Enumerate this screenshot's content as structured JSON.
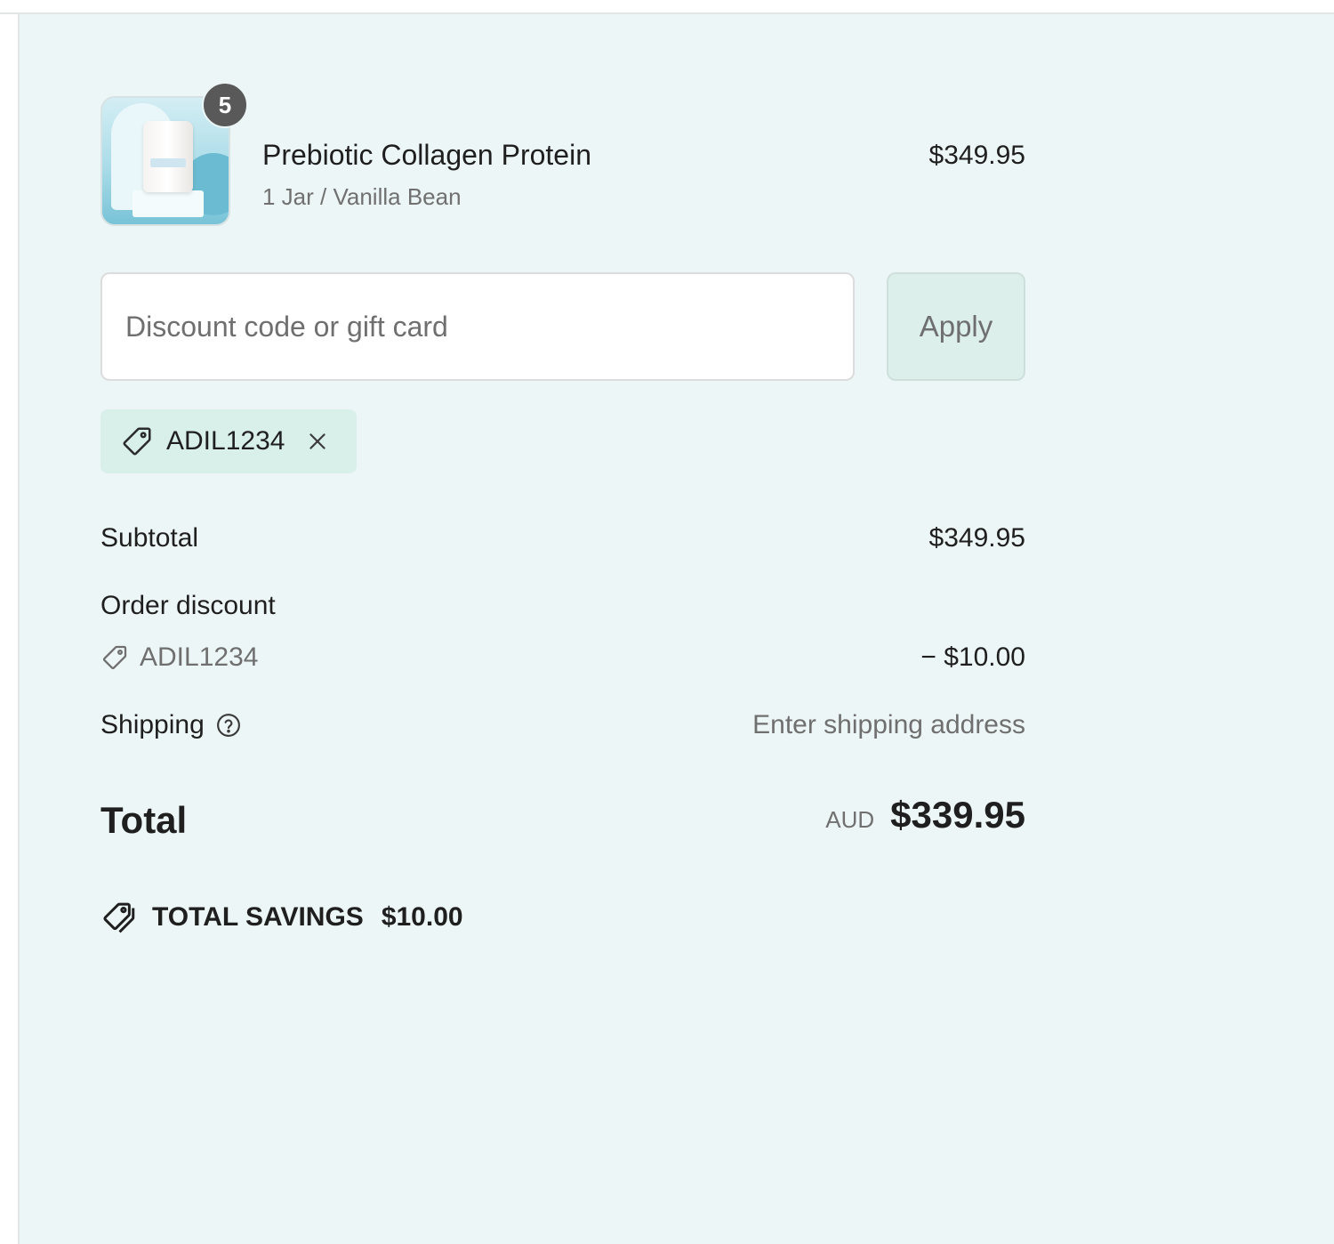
{
  "product": {
    "quantity": "5",
    "name": "Prebiotic Collagen Protein",
    "variant": "1 Jar / Vanilla Bean",
    "price": "$349.95",
    "image_icon": "product-jar-image"
  },
  "discount": {
    "placeholder": "Discount code or gift card",
    "value": "",
    "apply_label": "Apply",
    "applied_code": "ADIL1234"
  },
  "totals": {
    "subtotal_label": "Subtotal",
    "subtotal_value": "$349.95",
    "order_discount_label": "Order discount",
    "order_discount_code": "ADIL1234",
    "order_discount_value": "− $10.00",
    "shipping_label": "Shipping",
    "shipping_value": "Enter shipping address",
    "total_label": "Total",
    "currency": "AUD",
    "total_value": "$339.95"
  },
  "savings": {
    "label": "TOTAL SAVINGS",
    "amount": "$10.00"
  },
  "colors": {
    "panel_background": "#edf6f6",
    "chip_background": "#d9efe9",
    "apply_button_background": "#dcefea",
    "badge": "#595959",
    "text_primary": "#1f1f1f",
    "text_muted": "#6f6f6f"
  },
  "icons": {
    "chip_tag": "tag-icon",
    "chip_remove": "close-icon",
    "discount_tag": "tag-icon",
    "shipping_help": "help-circle-icon",
    "savings": "double-tag-icon"
  }
}
